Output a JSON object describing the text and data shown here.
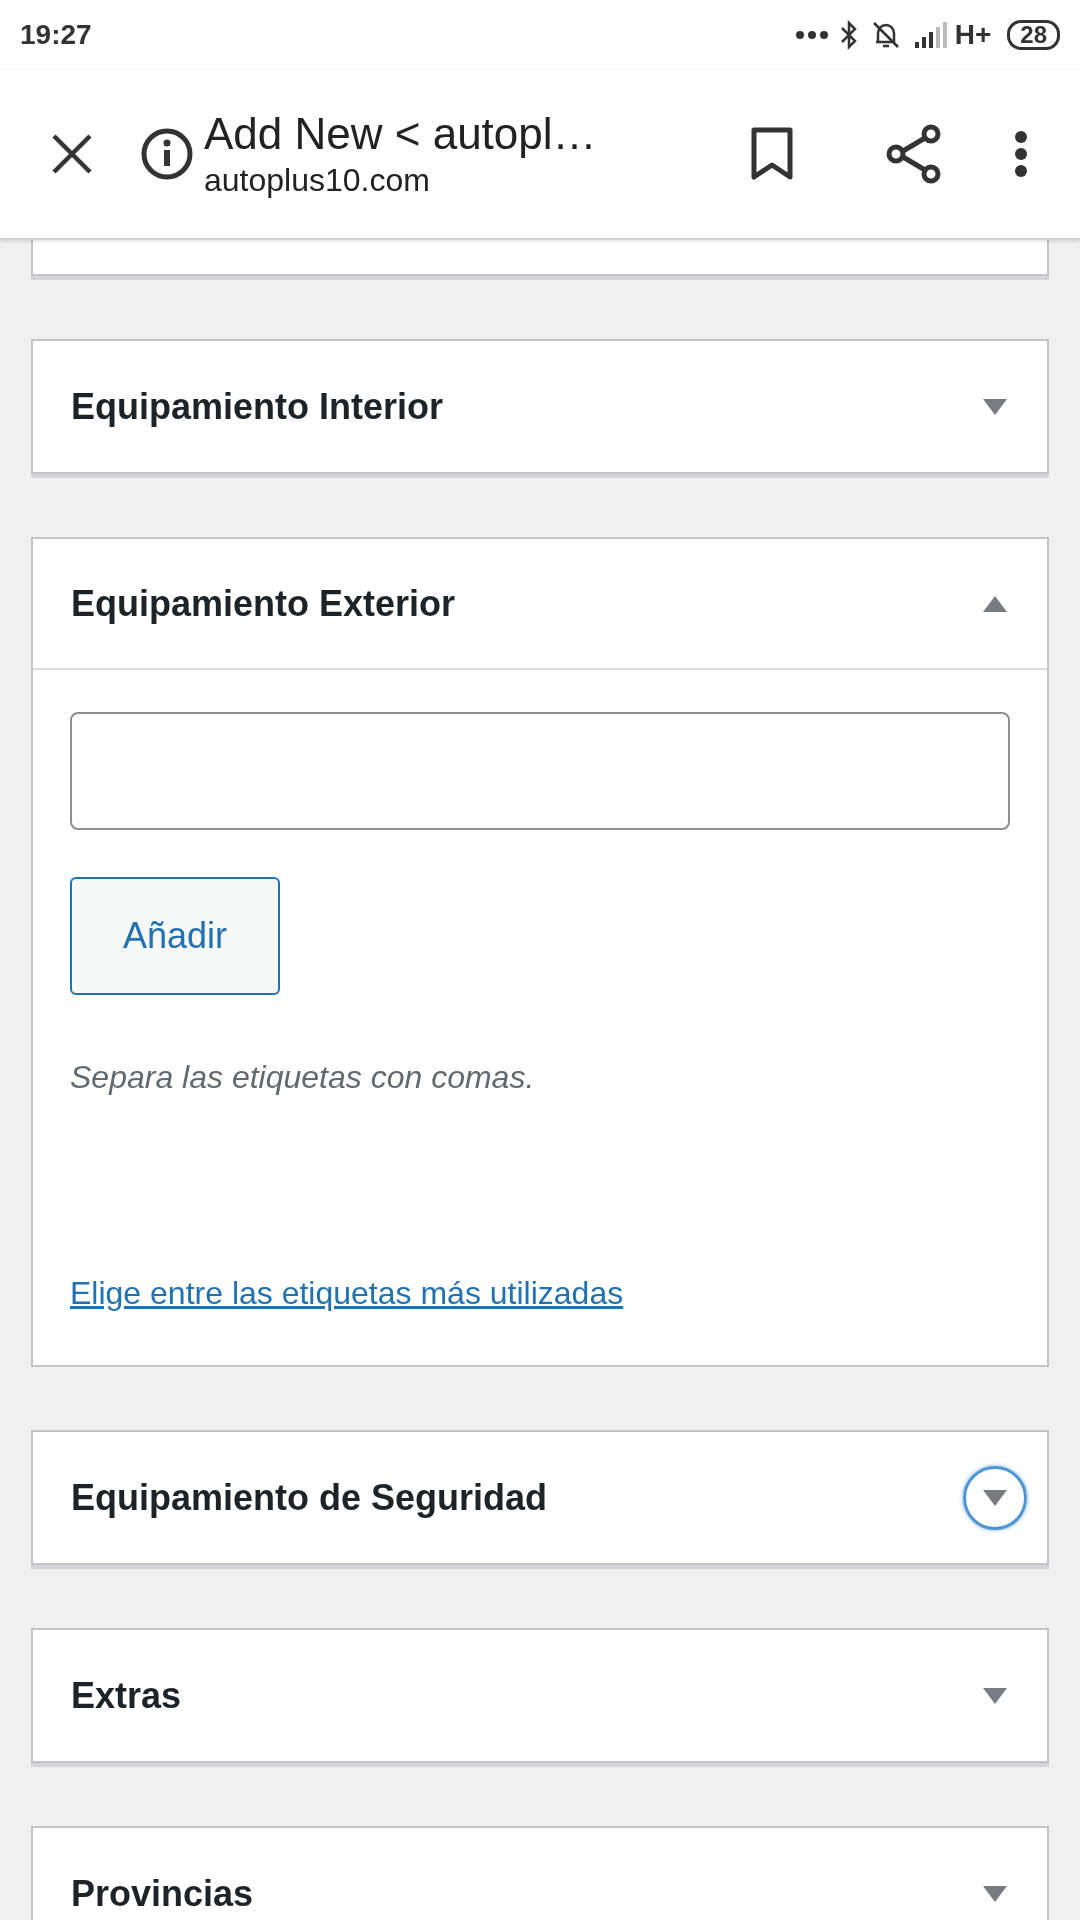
{
  "status_bar": {
    "time": "19:27",
    "network": "H+",
    "battery": "28"
  },
  "browser_header": {
    "title": "Add New < autopl…",
    "domain": "autoplus10.com"
  },
  "panels": [
    {
      "title": "Equipamiento Interior",
      "expanded": false,
      "focused": false
    },
    {
      "title": "Equipamiento Exterior",
      "expanded": true,
      "focused": false,
      "body": {
        "button": "Añadir",
        "hint": "Separa las etiquetas con comas.",
        "link": "Elige entre las etiquetas más utilizadas"
      }
    },
    {
      "title": "Equipamiento de Seguridad",
      "expanded": false,
      "focused": true
    },
    {
      "title": "Extras",
      "expanded": false,
      "focused": false
    },
    {
      "title": "Provincias",
      "expanded": false,
      "focused": false
    }
  ]
}
